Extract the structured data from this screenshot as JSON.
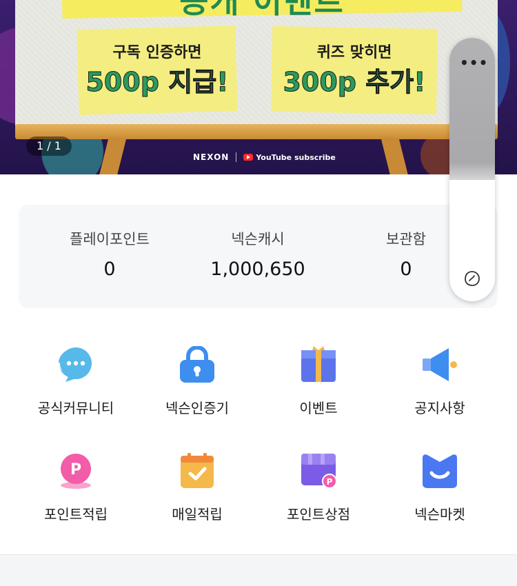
{
  "banner": {
    "title": "공개 이벤트",
    "note_left": {
      "sub": "구독 인증하면",
      "big": "500p 지급!"
    },
    "note_right": {
      "sub": "퀴즈 맞히면",
      "big": "300p 추가!"
    },
    "counter": "1 / 1",
    "brand": "NEXON",
    "youtube_label": "YouTube subscribe"
  },
  "points": [
    {
      "label": "플레이포인트",
      "value": "0"
    },
    {
      "label": "넥슨캐시",
      "value": "1,000,650"
    },
    {
      "label": "보관함",
      "value": "0"
    }
  ],
  "float_panel": {
    "menu_label": "•••"
  },
  "menu": [
    {
      "label": "공식커뮤니티",
      "icon": "chat-bubble-icon"
    },
    {
      "label": "넥슨인증기",
      "icon": "lock-icon"
    },
    {
      "label": "이벤트",
      "icon": "gift-icon"
    },
    {
      "label": "공지사항",
      "icon": "megaphone-icon"
    },
    {
      "label": "포인트적립",
      "icon": "point-coin-icon"
    },
    {
      "label": "매일적립",
      "icon": "calendar-check-icon"
    },
    {
      "label": "포인트상점",
      "icon": "shop-icon"
    },
    {
      "label": "넥슨마켓",
      "icon": "market-icon"
    }
  ],
  "colors": {
    "chat": "#57b8ea",
    "lock": "#3e8ef0",
    "gift": "#5b74ec",
    "megaphone": "#3e8ef0",
    "point": "#f25ca8",
    "calendar": "#f5b84a",
    "shop": "#7b5ce6",
    "market": "#4a78f0"
  }
}
